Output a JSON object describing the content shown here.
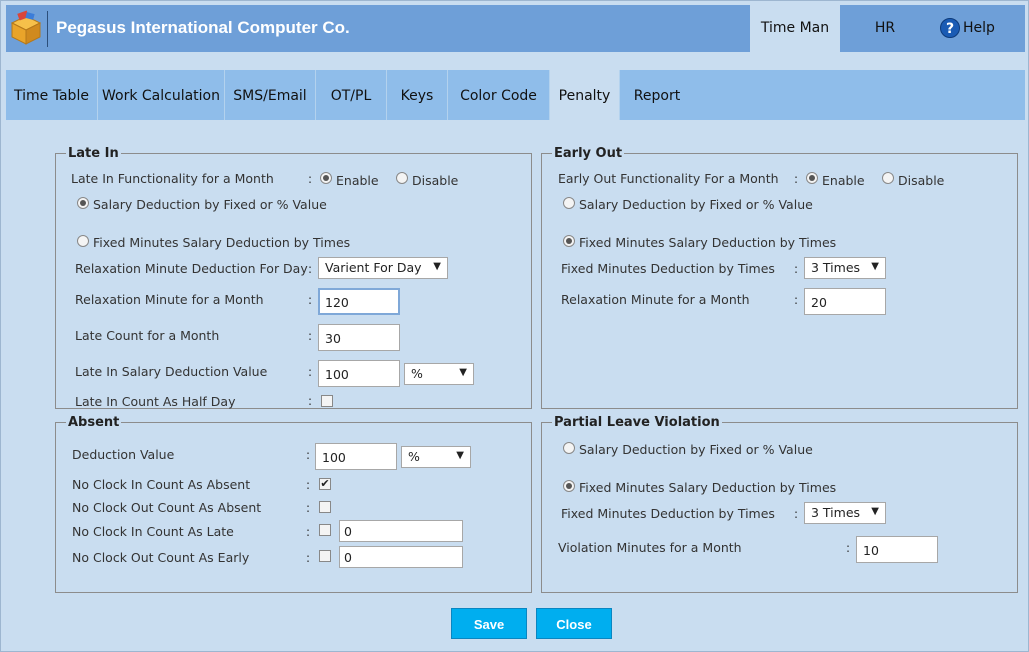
{
  "app": {
    "title": "Pegasus International Computer Co."
  },
  "top_nav": {
    "time_man": "Time Man",
    "hr": "HR",
    "help": "Help",
    "help_glyph": "?"
  },
  "tabs": [
    "Time Table",
    "Work Calculation",
    "SMS/Email",
    "OT/PL",
    "Keys",
    "Color Code",
    "Penalty",
    "Report"
  ],
  "active_tab": "Penalty",
  "colon": ":",
  "late_in": {
    "legend": "Late In",
    "functionality_label": "Late In Functionality for a Month",
    "enable": "Enable",
    "disable": "Disable",
    "enabled": true,
    "salary_fixed_label": "Salary Deduction by Fixed or % Value",
    "salary_fixed_selected": true,
    "fixed_minutes_label": "Fixed Minutes Salary Deduction by Times",
    "fixed_minutes_selected": false,
    "relax_day_label": "Relaxation Minute Deduction For Day",
    "relax_day_value": "Varient For Day",
    "relax_month_label": "Relaxation Minute for a Month",
    "relax_month_value": "120",
    "late_count_label": "Late Count for a Month",
    "late_count_value": "30",
    "deduction_label": "Late In Salary Deduction Value",
    "deduction_value": "100",
    "deduction_unit": "%",
    "half_day_label": "Late In Count As Half Day",
    "half_day_checked": false
  },
  "early_out": {
    "legend": "Early Out",
    "functionality_label": "Early Out Functionality For a Month",
    "enable": "Enable",
    "disable": "Disable",
    "enabled": true,
    "salary_fixed_label": "Salary Deduction by Fixed or % Value",
    "salary_fixed_selected": false,
    "fixed_minutes_label": "Fixed Minutes Salary Deduction by Times",
    "fixed_minutes_selected": true,
    "fixed_times_label": "Fixed Minutes Deduction by Times",
    "fixed_times_value": "3 Times",
    "relax_month_label": "Relaxation Minute for a Month",
    "relax_month_value": "20"
  },
  "absent": {
    "legend": "Absent",
    "deduction_label": "Deduction Value",
    "deduction_value": "100",
    "deduction_unit": "%",
    "no_clock_in_absent_label": "No Clock In Count As Absent",
    "no_clock_in_absent_checked": true,
    "no_clock_out_absent_label": "No Clock Out Count As Absent",
    "no_clock_out_absent_checked": false,
    "no_clock_in_late_label": "No Clock In Count As Late",
    "no_clock_in_late_checked": false,
    "no_clock_in_late_value": "0",
    "no_clock_out_early_label": "No Clock Out Count As Early",
    "no_clock_out_early_checked": false,
    "no_clock_out_early_value": "0"
  },
  "partial_leave": {
    "legend": "Partial Leave Violation",
    "salary_fixed_label": "Salary Deduction by Fixed or % Value",
    "salary_fixed_selected": false,
    "fixed_minutes_label": "Fixed Minutes Salary Deduction by Times",
    "fixed_minutes_selected": true,
    "fixed_times_label": "Fixed Minutes Deduction by Times",
    "fixed_times_value": "3 Times",
    "violation_label": "Violation Minutes for a Month",
    "violation_value": "10"
  },
  "buttons": {
    "save": "Save",
    "close": "Close"
  },
  "glyphs": {
    "dropdown_arrow": "▼",
    "check": "✔"
  }
}
